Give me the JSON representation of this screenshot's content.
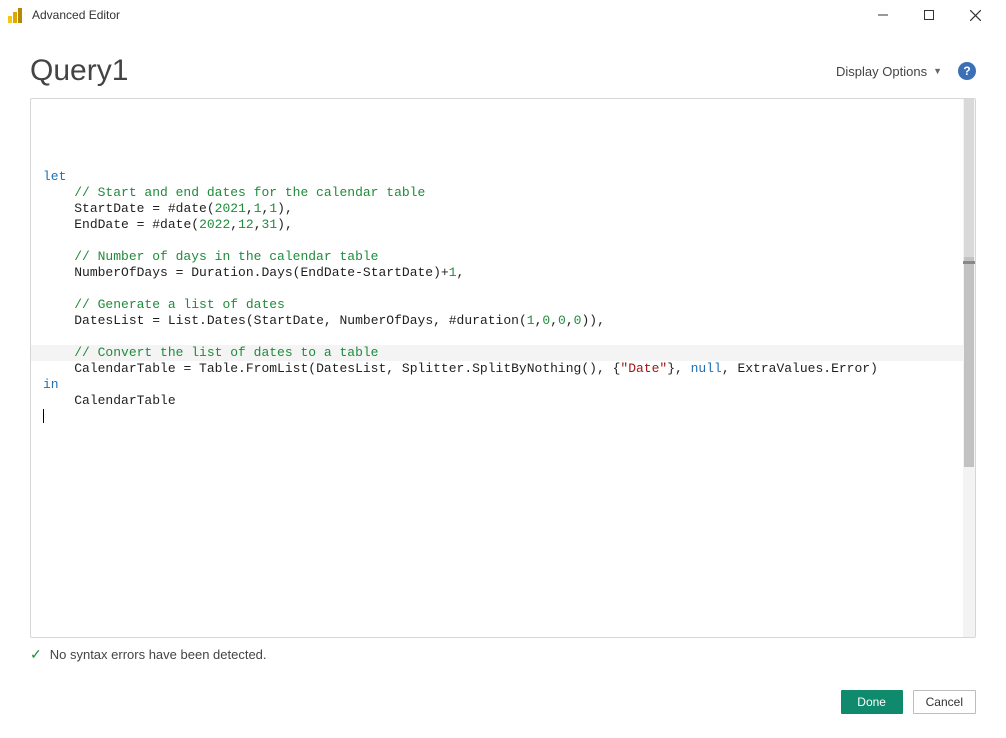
{
  "window": {
    "title": "Advanced Editor"
  },
  "header": {
    "query_name": "Query1",
    "display_options_label": "Display Options",
    "help_tooltip": "?"
  },
  "code": {
    "line1": {
      "kw": "let"
    },
    "line2": {
      "cm": "// Start and end dates for the calendar table"
    },
    "line3": {
      "id": "StartDate",
      "op1": " = ",
      "fn": "#date",
      "lp": "(",
      "n1": "2021",
      "c1": ",",
      "n2": "1",
      "c2": ",",
      "n3": "1",
      "rp": ")",
      "tc": ","
    },
    "line4": {
      "id": "EndDate",
      "op1": " = ",
      "fn": "#date",
      "lp": "(",
      "n1": "2022",
      "c1": ",",
      "n2": "12",
      "c2": ",",
      "n3": "31",
      "rp": ")",
      "tc": ","
    },
    "line5": {
      "blank": ""
    },
    "line6": {
      "cm": "// Number of days in the calendar table"
    },
    "line7": {
      "id": "NumberOfDays",
      "op1": " = ",
      "fn": "Duration.Days",
      "lp": "(",
      "arg": "EndDate-StartDate",
      "rp": ")",
      "plus": "+",
      "n1": "1",
      "tc": ","
    },
    "line8": {
      "blank": ""
    },
    "line9": {
      "cm": "// Generate a list of dates"
    },
    "line10": {
      "id": "DatesList",
      "op1": " = ",
      "fn": "List.Dates",
      "lp": "(",
      "a1": "StartDate",
      "c1": ", ",
      "a2": "NumberOfDays",
      "c2": ", ",
      "fn2": "#duration",
      "lp2": "(",
      "n1": "1",
      "cma": ",",
      "n2": "0",
      "cmb": ",",
      "n3": "0",
      "cmc": ",",
      "n4": "0",
      "rp2": ")",
      "rp": ")",
      "tc": ","
    },
    "line11": {
      "blank": ""
    },
    "line12": {
      "cm": "// Convert the list of dates to a table"
    },
    "line13": {
      "id": "CalendarTable",
      "op1": " = ",
      "fn": "Table.FromList",
      "lp": "(",
      "a1": "DatesList",
      "c1": ", ",
      "fn2": "Splitter.SplitByNothing",
      "lp2": "(",
      "rp2": ")",
      "c2": ", ",
      "lb": "{",
      "str": "\"Date\"",
      "rb": "}",
      "c3": ", ",
      "nul": "null",
      "c4": ", ",
      "a2": "ExtraValues.Error",
      "rp": ")"
    },
    "line14": {
      "kw": "in"
    },
    "line15": {
      "id": "CalendarTable"
    }
  },
  "status": {
    "message": "No syntax errors have been detected."
  },
  "footer": {
    "done_label": "Done",
    "cancel_label": "Cancel"
  }
}
